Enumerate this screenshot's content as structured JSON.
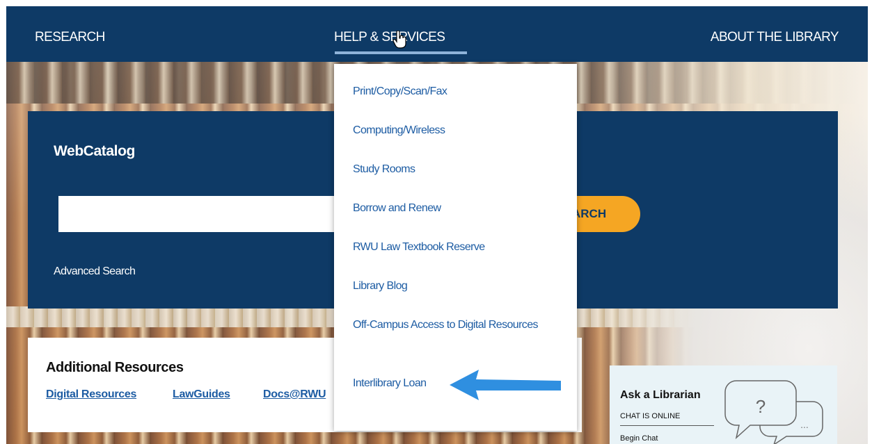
{
  "nav": {
    "research": "RESEARCH",
    "help_services": "HELP & SERVICES",
    "about": "ABOUT THE LIBRARY"
  },
  "catalog": {
    "title": "WebCatalog",
    "search_value": "",
    "search_button": "ARCH",
    "advanced_search": "Advanced Search"
  },
  "additional": {
    "title": "Additional Resources",
    "links": [
      "Digital Resources",
      "LawGuides",
      "Docs@RWU"
    ]
  },
  "ask": {
    "title": "Ask a Librarian",
    "status": "CHAT IS ONLINE",
    "begin": "Begin Chat",
    "bubble_symbol": "?",
    "bubble_dots": "..."
  },
  "dropdown": {
    "items": [
      "Print/Copy/Scan/Fax",
      "Computing/Wireless",
      "Study Rooms",
      "Borrow and Renew",
      "RWU Law Textbook Reserve",
      "Library Blog",
      "Off-Campus Access to Digital Resources",
      "Interlibrary Loan"
    ]
  },
  "colors": {
    "navy": "#0e3a66",
    "link_blue": "#1d5ca3",
    "search_button": "#f5a623",
    "annotation_arrow": "#2f8fe0"
  }
}
